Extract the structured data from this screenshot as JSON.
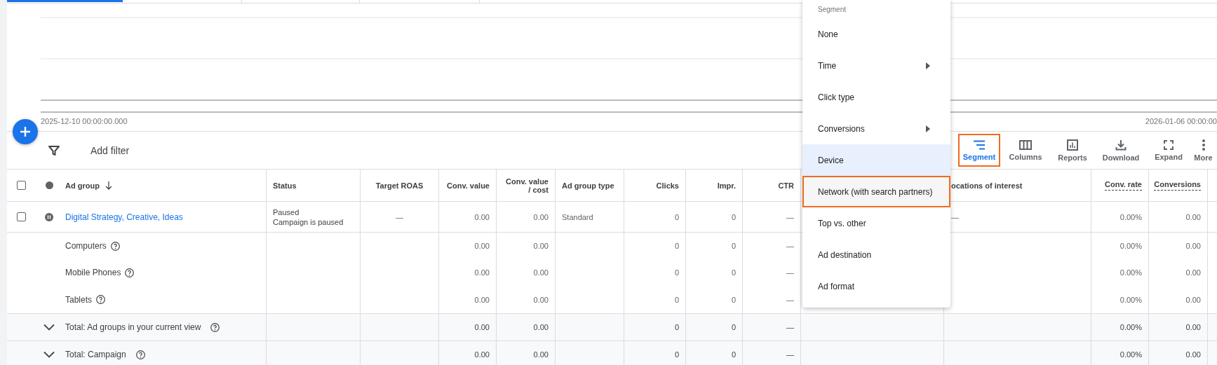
{
  "chart": {
    "x_start": "2025-12-10 00:00:00.000",
    "x_end": "2026-01-06 00:00:00"
  },
  "filter": {
    "label": "Add filter"
  },
  "toolbar": [
    {
      "label": "Segment",
      "selected": true,
      "highlighted": true
    },
    {
      "label": "Columns",
      "selected": false,
      "highlighted": false
    },
    {
      "label": "Reports",
      "selected": false,
      "highlighted": false
    },
    {
      "label": "Download",
      "selected": false,
      "highlighted": false
    },
    {
      "label": "Expand",
      "selected": false,
      "highlighted": false
    },
    {
      "label": "More",
      "selected": false,
      "highlighted": false
    }
  ],
  "table": {
    "select_all": {
      "checked": false
    },
    "columns": [
      {
        "label": "Ad group",
        "sorted": true,
        "tooltip": false
      },
      {
        "label": "Status",
        "sorted": false,
        "tooltip": false
      },
      {
        "label": "Target ROAS",
        "sorted": false,
        "tooltip": false
      },
      {
        "label": "Conv. value",
        "sorted": false,
        "tooltip": false
      },
      {
        "label": "Conv. value / cost",
        "sorted": false,
        "tooltip": false
      },
      {
        "label": "Ad group type",
        "sorted": false,
        "tooltip": false
      },
      {
        "label": "Clicks",
        "sorted": false,
        "tooltip": false
      },
      {
        "label": "Impr.",
        "sorted": false,
        "tooltip": false
      },
      {
        "label": "CTR",
        "sorted": false,
        "tooltip": false
      },
      {
        "label": "ocations of interest",
        "sorted": false,
        "tooltip": false
      },
      {
        "label": "Conv. rate",
        "sorted": false,
        "tooltip": true
      },
      {
        "label": "Conversions",
        "sorted": false,
        "tooltip": true
      }
    ],
    "rows": [
      {
        "kind": "ad_group",
        "checked": false,
        "ad_group": "Digital Strategy, Creative, Ideas",
        "status": "Paused",
        "status_detail": "Campaign is paused",
        "target_roas": "—",
        "conv_value": "0.00",
        "conv_value_cost": "0.00",
        "ad_group_type": "Standard",
        "clicks": "0",
        "impr": "0",
        "ctr": "—",
        "locations": "—",
        "conv_rate": "0.00%",
        "conversions": "0.00"
      },
      {
        "kind": "segment",
        "ad_group": "Computers",
        "conv_value": "0.00",
        "conv_value_cost": "0.00",
        "clicks": "0",
        "impr": "0",
        "ctr": "—",
        "conv_rate": "0.00%",
        "conversions": "0.00"
      },
      {
        "kind": "segment",
        "ad_group": "Mobile Phones",
        "conv_value": "0.00",
        "conv_value_cost": "0.00",
        "clicks": "0",
        "impr": "0",
        "ctr": "—",
        "conv_rate": "0.00%",
        "conversions": "0.00"
      },
      {
        "kind": "segment",
        "ad_group": "Tablets",
        "conv_value": "0.00",
        "conv_value_cost": "0.00",
        "clicks": "0",
        "impr": "0",
        "ctr": "—",
        "conv_rate": "0.00%",
        "conversions": "0.00"
      },
      {
        "kind": "total",
        "ad_group": "Total: Ad groups in your current view",
        "conv_value": "0.00",
        "conv_value_cost": "0.00",
        "clicks": "0",
        "impr": "0",
        "ctr": "—",
        "conv_rate": "0.00%",
        "conversions": "0.00"
      },
      {
        "kind": "total",
        "ad_group": "Total: Campaign",
        "conv_value": "0.00",
        "conv_value_cost": "0.00",
        "clicks": "0",
        "impr": "0",
        "ctr": "—",
        "conv_rate": "0.00%",
        "conversions": "0.00"
      }
    ]
  },
  "segment_menu": {
    "title": "Segment",
    "items": [
      {
        "label": "None",
        "submenu": false,
        "selected": false,
        "highlighted": false
      },
      {
        "label": "Time",
        "submenu": true,
        "selected": false,
        "highlighted": false
      },
      {
        "label": "Click type",
        "submenu": false,
        "selected": false,
        "highlighted": false
      },
      {
        "label": "Conversions",
        "submenu": true,
        "selected": false,
        "highlighted": false
      },
      {
        "label": "Device",
        "submenu": false,
        "selected": true,
        "highlighted": false
      },
      {
        "label": "Network (with search partners)",
        "submenu": false,
        "selected": false,
        "highlighted": true
      },
      {
        "label": "Top vs. other",
        "submenu": false,
        "selected": false,
        "highlighted": false
      },
      {
        "label": "Ad destination",
        "submenu": false,
        "selected": false,
        "highlighted": false
      },
      {
        "label": "Ad format",
        "submenu": false,
        "selected": false,
        "highlighted": false
      }
    ]
  }
}
